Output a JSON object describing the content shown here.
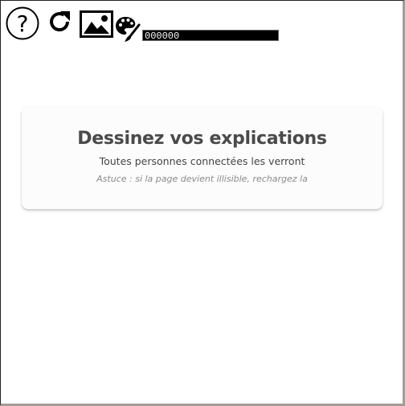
{
  "toolbar": {
    "help_icon": "help-circle-icon",
    "reload_icon": "reload-icon",
    "image_icon": "image-icon",
    "palette_icon": "palette-brush-icon",
    "color_value": "000000",
    "color_field_bg": "#000000",
    "color_field_text": "#ffffff"
  },
  "card": {
    "title": "Dessinez vos explications",
    "subtitle": "Toutes personnes connectées les verront",
    "tip": "Astuce : si la page devient illisible, rechargez la"
  }
}
